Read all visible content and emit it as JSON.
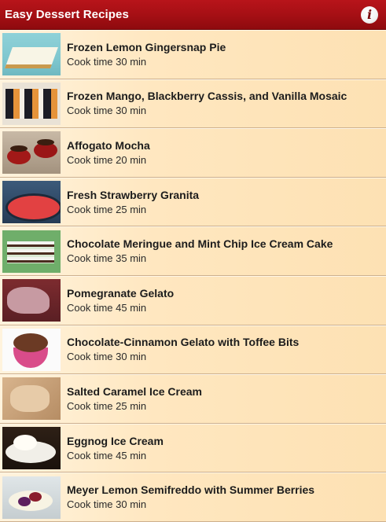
{
  "header": {
    "title": "Easy Dessert Recipes",
    "info_icon": "info-icon",
    "info_glyph": "i"
  },
  "recipes": [
    {
      "title": "Frozen Lemon Gingersnap Pie",
      "cook": "Cook time 30 min"
    },
    {
      "title": "Frozen Mango, Blackberry Cassis, and Vanilla Mosaic",
      "cook": "Cook time 30 min"
    },
    {
      "title": "Affogato Mocha",
      "cook": "Cook time 20 min"
    },
    {
      "title": "Fresh Strawberry Granita",
      "cook": "Cook time 25 min"
    },
    {
      "title": "Chocolate Meringue and Mint Chip Ice Cream Cake",
      "cook": "Cook time 35 min"
    },
    {
      "title": "Pomegranate Gelato",
      "cook": "Cook time 45 min"
    },
    {
      "title": "Chocolate-Cinnamon Gelato with Toffee Bits",
      "cook": "Cook time 30 min"
    },
    {
      "title": "Salted Caramel Ice Cream",
      "cook": "Cook time 25 min"
    },
    {
      "title": "Eggnog Ice Cream",
      "cook": "Cook time 45 min"
    },
    {
      "title": "Meyer Lemon Semifreddo with Summer Berries",
      "cook": "Cook time 30 min"
    }
  ],
  "colors": {
    "header_red": "#a40f14",
    "row_background": "#fde6bd",
    "row_divider": "#cdb08e"
  }
}
